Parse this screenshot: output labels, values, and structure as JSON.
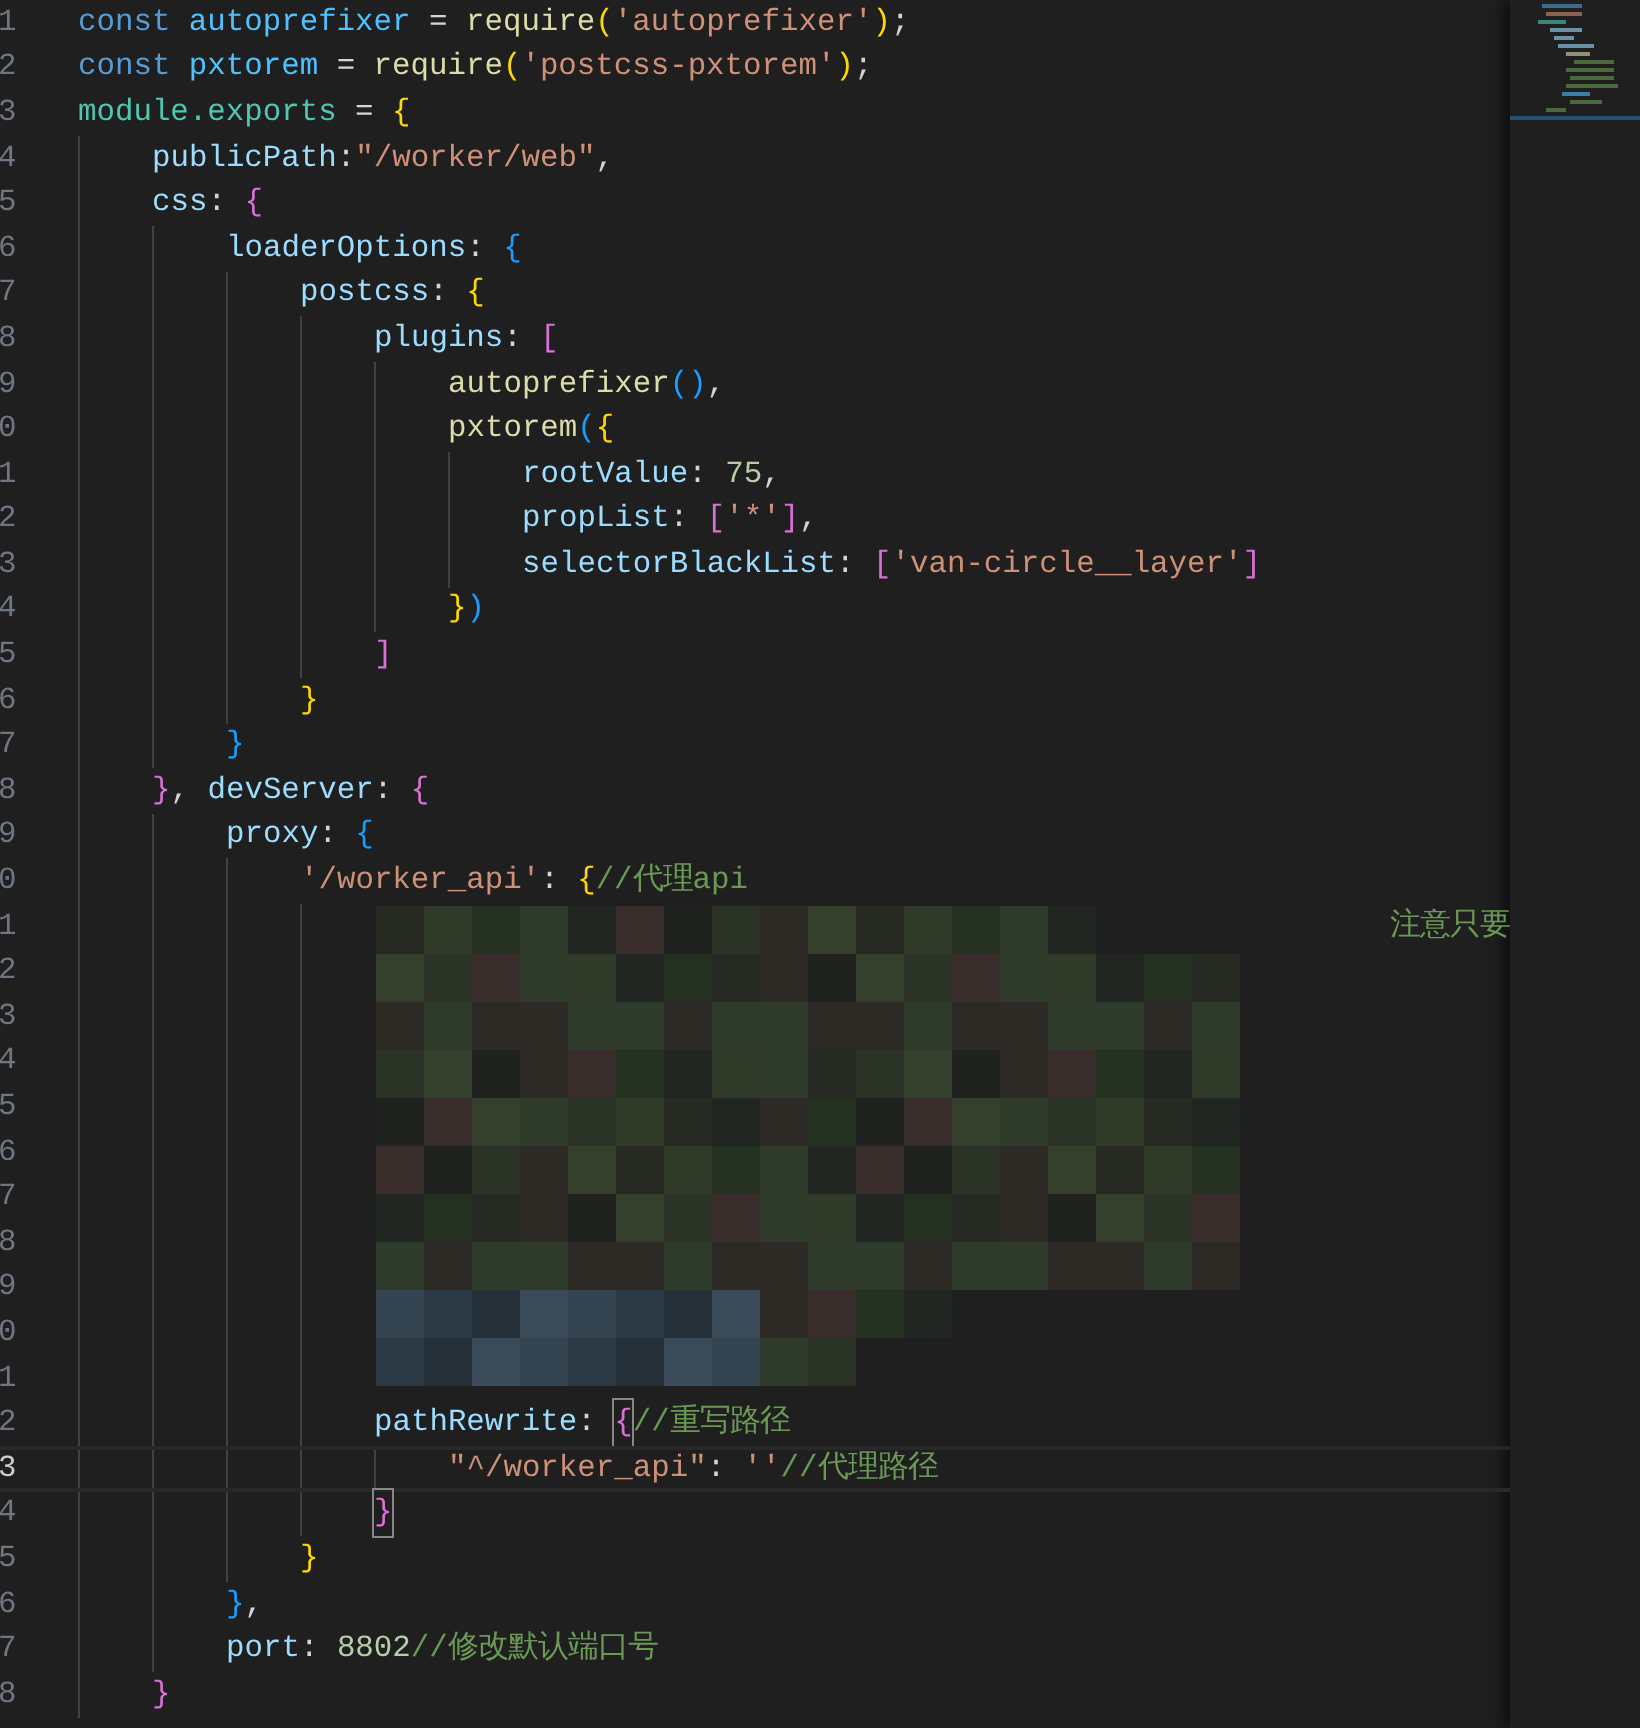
{
  "editor": {
    "lines": [
      {
        "number": "1",
        "current": false,
        "tokens": [
          {
            "text": "const ",
            "kind": "keyword"
          },
          {
            "text": "autoprefixer",
            "kind": "variable"
          },
          {
            "text": " = ",
            "kind": "punct"
          },
          {
            "text": "require",
            "kind": "function"
          },
          {
            "text": "(",
            "kind": "bracket1"
          },
          {
            "text": "'autoprefixer'",
            "kind": "string"
          },
          {
            "text": ")",
            "kind": "bracket1"
          },
          {
            "text": ";",
            "kind": "punct"
          }
        ]
      },
      {
        "number": "2",
        "current": false,
        "tokens": [
          {
            "text": "const ",
            "kind": "keyword"
          },
          {
            "text": "pxtorem",
            "kind": "variable"
          },
          {
            "text": " = ",
            "kind": "punct"
          },
          {
            "text": "require",
            "kind": "function"
          },
          {
            "text": "(",
            "kind": "bracket1"
          },
          {
            "text": "'postcss-pxtorem'",
            "kind": "string"
          },
          {
            "text": ")",
            "kind": "bracket1"
          },
          {
            "text": ";",
            "kind": "punct"
          }
        ]
      },
      {
        "number": "3",
        "current": false,
        "tokens": [
          {
            "text": "module.exports",
            "kind": "type"
          },
          {
            "text": " = ",
            "kind": "punct"
          },
          {
            "text": "{",
            "kind": "bracket1"
          }
        ],
        "children": [
          {
            "number": "4",
            "current": false,
            "tokens": [
              {
                "text": "publicPath",
                "kind": "property"
              },
              {
                "text": ":",
                "kind": "punct"
              },
              {
                "text": "\"/worker/web\"",
                "kind": "string"
              },
              {
                "text": ",",
                "kind": "punct"
              }
            ]
          },
          {
            "number": "5",
            "current": false,
            "tokens": [
              {
                "text": "css",
                "kind": "property"
              },
              {
                "text": ": ",
                "kind": "punct"
              },
              {
                "text": "{",
                "kind": "bracket2"
              }
            ],
            "children": [
              {
                "number": "6",
                "current": false,
                "tokens": [
                  {
                    "text": "loaderOptions",
                    "kind": "property"
                  },
                  {
                    "text": ": ",
                    "kind": "punct"
                  },
                  {
                    "text": "{",
                    "kind": "bracket3"
                  }
                ],
                "children": [
                  {
                    "number": "7",
                    "current": false,
                    "tokens": [
                      {
                        "text": "postcss",
                        "kind": "property"
                      },
                      {
                        "text": ": ",
                        "kind": "punct"
                      },
                      {
                        "text": "{",
                        "kind": "bracket1"
                      }
                    ],
                    "children": [
                      {
                        "number": "8",
                        "current": false,
                        "tokens": [
                          {
                            "text": "plugins",
                            "kind": "property"
                          },
                          {
                            "text": ": ",
                            "kind": "punct"
                          },
                          {
                            "text": "[",
                            "kind": "bracket2"
                          }
                        ],
                        "children": [
                          {
                            "number": "9",
                            "current": false,
                            "tokens": [
                              {
                                "text": "autoprefixer",
                                "kind": "function"
                              },
                              {
                                "text": "()",
                                "kind": "bracket3"
                              },
                              {
                                "text": ",",
                                "kind": "punct"
                              }
                            ]
                          },
                          {
                            "number": "0",
                            "current": false,
                            "tokens": [
                              {
                                "text": "pxtorem",
                                "kind": "function"
                              },
                              {
                                "text": "(",
                                "kind": "bracket3"
                              },
                              {
                                "text": "{",
                                "kind": "bracket1"
                              }
                            ],
                            "children": [
                              {
                                "number": "1",
                                "current": false,
                                "tokens": [
                                  {
                                    "text": "rootValue",
                                    "kind": "property"
                                  },
                                  {
                                    "text": ": ",
                                    "kind": "punct"
                                  },
                                  {
                                    "text": "75",
                                    "kind": "number"
                                  },
                                  {
                                    "text": ",",
                                    "kind": "punct"
                                  }
                                ]
                              },
                              {
                                "number": "2",
                                "current": false,
                                "tokens": [
                                  {
                                    "text": "propList",
                                    "kind": "property"
                                  },
                                  {
                                    "text": ": ",
                                    "kind": "punct"
                                  },
                                  {
                                    "text": "[",
                                    "kind": "bracket2"
                                  },
                                  {
                                    "text": "'*'",
                                    "kind": "string"
                                  },
                                  {
                                    "text": "]",
                                    "kind": "bracket2"
                                  },
                                  {
                                    "text": ",",
                                    "kind": "punct"
                                  }
                                ]
                              },
                              {
                                "number": "3",
                                "current": false,
                                "tokens": [
                                  {
                                    "text": "selectorBlackList",
                                    "kind": "property"
                                  },
                                  {
                                    "text": ": ",
                                    "kind": "punct"
                                  },
                                  {
                                    "text": "[",
                                    "kind": "bracket2"
                                  },
                                  {
                                    "text": "'van-circle__layer'",
                                    "kind": "string"
                                  },
                                  {
                                    "text": "]",
                                    "kind": "bracket2"
                                  }
                                ]
                              }
                            ]
                          },
                          {
                            "number": "4",
                            "current": false,
                            "tokens": [
                              {
                                "text": "}",
                                "kind": "bracket1"
                              },
                              {
                                "text": ")",
                                "kind": "bracket3"
                              }
                            ]
                          }
                        ]
                      },
                      {
                        "number": "5",
                        "current": false,
                        "tokens": [
                          {
                            "text": "]",
                            "kind": "bracket2"
                          }
                        ]
                      }
                    ]
                  },
                  {
                    "number": "6",
                    "current": false,
                    "tokens": [
                      {
                        "text": "}",
                        "kind": "bracket1"
                      }
                    ]
                  }
                ]
              },
              {
                "number": "7",
                "current": false,
                "tokens": [
                  {
                    "text": "}",
                    "kind": "bracket3"
                  }
                ]
              }
            ]
          },
          {
            "number": "8",
            "current": false,
            "tokens": [
              {
                "text": "}",
                "kind": "bracket2"
              },
              {
                "text": ", ",
                "kind": "punct"
              },
              {
                "text": "devServer",
                "kind": "property"
              },
              {
                "text": ": ",
                "kind": "punct"
              },
              {
                "text": "{",
                "kind": "bracket2"
              }
            ],
            "children": [
              {
                "number": "9",
                "current": false,
                "tokens": [
                  {
                    "text": "proxy",
                    "kind": "property"
                  },
                  {
                    "text": ": ",
                    "kind": "punct"
                  },
                  {
                    "text": "{",
                    "kind": "bracket3"
                  }
                ],
                "children": [
                  {
                    "number": "0",
                    "current": false,
                    "tokens": [
                      {
                        "text": "'/worker_api'",
                        "kind": "string"
                      },
                      {
                        "text": ": ",
                        "kind": "punct"
                      },
                      {
                        "text": "{",
                        "kind": "bracket1"
                      },
                      {
                        "text": "//代理api",
                        "kind": "comment"
                      }
                    ],
                    "children": [
                      {
                        "number": "1",
                        "current": false,
                        "tokens": [
                          {
                            "text": "注意只要",
                            "kind": "fragment"
                          }
                        ]
                      },
                      {
                        "number": "2",
                        "current": false
                      },
                      {
                        "number": "3",
                        "current": false
                      },
                      {
                        "number": "4",
                        "current": false
                      },
                      {
                        "number": "5",
                        "current": false
                      },
                      {
                        "number": "6",
                        "current": false
                      },
                      {
                        "number": "7",
                        "current": false
                      },
                      {
                        "number": "8",
                        "current": false
                      },
                      {
                        "number": "9",
                        "current": false
                      },
                      {
                        "number": "0",
                        "current": false
                      },
                      {
                        "number": "1",
                        "current": false
                      },
                      {
                        "number": "2",
                        "current": false,
                        "tokens": [
                          {
                            "text": "pathRewrite",
                            "kind": "property"
                          },
                          {
                            "text": ": ",
                            "kind": "punct"
                          },
                          {
                            "text": "{",
                            "kind": "bracket2",
                            "matched": true
                          },
                          {
                            "text": "//重写路径",
                            "kind": "comment"
                          }
                        ],
                        "children": [
                          {
                            "number": "3",
                            "current": true,
                            "tokens": [
                              {
                                "text": "\"^/worker_api\"",
                                "kind": "string"
                              },
                              {
                                "text": ": ",
                                "kind": "punct"
                              },
                              {
                                "text": "''",
                                "kind": "string"
                              },
                              {
                                "text": "//代理路径",
                                "kind": "comment"
                              }
                            ]
                          }
                        ]
                      },
                      {
                        "number": "4",
                        "current": false,
                        "tokens": [
                          {
                            "text": "}",
                            "kind": "bracket2",
                            "matched": true
                          }
                        ]
                      }
                    ]
                  },
                  {
                    "number": "5",
                    "current": false,
                    "tokens": [
                      {
                        "text": "}",
                        "kind": "bracket1"
                      }
                    ]
                  }
                ]
              },
              {
                "number": "6",
                "current": false,
                "tokens": [
                  {
                    "text": "}",
                    "kind": "bracket3"
                  },
                  {
                    "text": ",",
                    "kind": "punct"
                  }
                ]
              },
              {
                "number": "7",
                "current": false,
                "tokens": [
                  {
                    "text": "port",
                    "kind": "property"
                  },
                  {
                    "text": ": ",
                    "kind": "punct"
                  },
                  {
                    "text": "8802",
                    "kind": "number"
                  },
                  {
                    "text": "//修改默认端口号",
                    "kind": "comment"
                  }
                ]
              }
            ]
          },
          {
            "number": "8",
            "current": false,
            "tokens": [
              {
                "text": "}",
                "kind": "bracket2"
              }
            ]
          }
        ]
      }
    ]
  }
}
